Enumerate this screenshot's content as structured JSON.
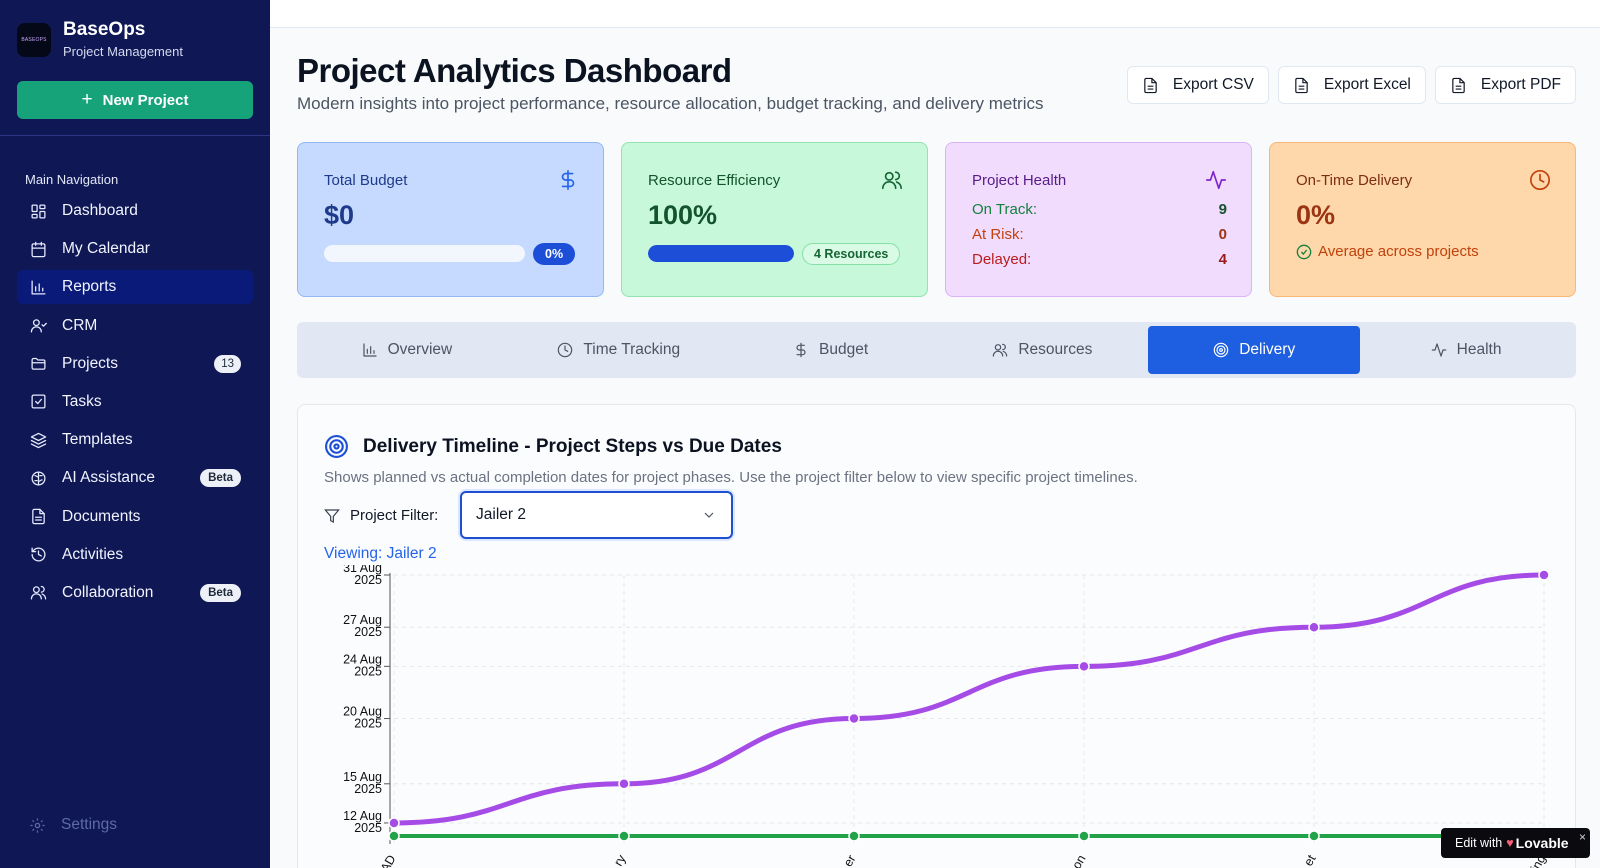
{
  "brand": {
    "name": "BaseOps",
    "subtitle": "Project Management",
    "logo_text": "BASEOPS"
  },
  "sidebar": {
    "new_project": "New Project",
    "heading": "Main Navigation",
    "items": [
      {
        "label": "Dashboard",
        "icon": "dashboard-icon"
      },
      {
        "label": "My Calendar",
        "icon": "calendar-icon"
      },
      {
        "label": "Reports",
        "icon": "bar-chart-icon",
        "active": true
      },
      {
        "label": "CRM",
        "icon": "user-icon"
      },
      {
        "label": "Projects",
        "icon": "folder-icon",
        "badge": "13"
      },
      {
        "label": "Tasks",
        "icon": "checkbox-icon"
      },
      {
        "label": "Templates",
        "icon": "layers-icon"
      },
      {
        "label": "AI Assistance",
        "icon": "brain-icon",
        "badge": "Beta"
      },
      {
        "label": "Documents",
        "icon": "document-icon"
      },
      {
        "label": "Activities",
        "icon": "history-icon"
      },
      {
        "label": "Collaboration",
        "icon": "users-icon",
        "badge": "Beta"
      }
    ],
    "settings": "Settings"
  },
  "header": {
    "title": "Project Analytics Dashboard",
    "subtitle": "Modern insights into project performance, resource allocation, budget tracking, and delivery metrics",
    "exports": [
      "Export CSV",
      "Export Excel",
      "Export PDF"
    ]
  },
  "cards": {
    "budget": {
      "title": "Total Budget",
      "value": "$0",
      "progress_pct": 0,
      "pill": "0%"
    },
    "efficiency": {
      "title": "Resource Efficiency",
      "value": "100%",
      "progress_pct": 100,
      "pill": "4 Resources"
    },
    "health": {
      "title": "Project Health",
      "on_track_label": "On Track:",
      "on_track": "9",
      "at_risk_label": "At Risk:",
      "at_risk": "0",
      "delayed_label": "Delayed:",
      "delayed": "4"
    },
    "delivery": {
      "title": "On-Time Delivery",
      "value": "0%",
      "note": "Average across projects"
    }
  },
  "tabs": [
    {
      "label": "Overview",
      "icon": "bar-chart-icon"
    },
    {
      "label": "Time Tracking",
      "icon": "clock-icon"
    },
    {
      "label": "Budget",
      "icon": "dollar-icon"
    },
    {
      "label": "Resources",
      "icon": "users-icon"
    },
    {
      "label": "Delivery",
      "icon": "target-icon",
      "active": true
    },
    {
      "label": "Health",
      "icon": "activity-icon"
    }
  ],
  "panel": {
    "title": "Delivery Timeline - Project Steps vs Due Dates",
    "description": "Shows planned vs actual completion dates for project phases. Use the project filter below to view specific project timelines.",
    "filter_label": "Project Filter:",
    "filter_value": "Jailer 2",
    "viewing": "Viewing: Jailer 2"
  },
  "chart_data": {
    "type": "line",
    "y_ticks": [
      {
        "date": "12 Aug 2025",
        "line1": "12 Aug",
        "line2": "2025"
      },
      {
        "date": "15 Aug 2025",
        "line1": "15 Aug",
        "line2": "2025"
      },
      {
        "date": "20 Aug 2025",
        "line1": "20 Aug",
        "line2": "2025"
      },
      {
        "date": "24 Aug 2025",
        "line1": "24 Aug",
        "line2": "2025"
      },
      {
        "date": "27 Aug 2025",
        "line1": "27 Aug",
        "line2": "2025"
      },
      {
        "date": "31 Aug 2025",
        "line1": "31 Aug",
        "line2": "2025"
      }
    ],
    "x_labels": [
      "AD",
      "ry",
      "er",
      "on",
      "et",
      "ing"
    ],
    "ylim": [
      "11 Aug 2025",
      "31 Aug 2025"
    ],
    "grid": true,
    "series": [
      {
        "color": "#a64ce6",
        "values": [
          "12 Aug 2025",
          "15 Aug 2025",
          "20 Aug 2025",
          "24 Aug 2025",
          "27 Aug 2025",
          "31 Aug 2025"
        ]
      },
      {
        "color": "#22a34a",
        "values": [
          "11 Aug 2025",
          "11 Aug 2025",
          "11 Aug 2025",
          "11 Aug 2025",
          "11 Aug 2025",
          "11 Aug 2025"
        ]
      }
    ]
  },
  "lovable": {
    "prefix": "Edit with",
    "brand": "Lovable",
    "close": "×"
  }
}
